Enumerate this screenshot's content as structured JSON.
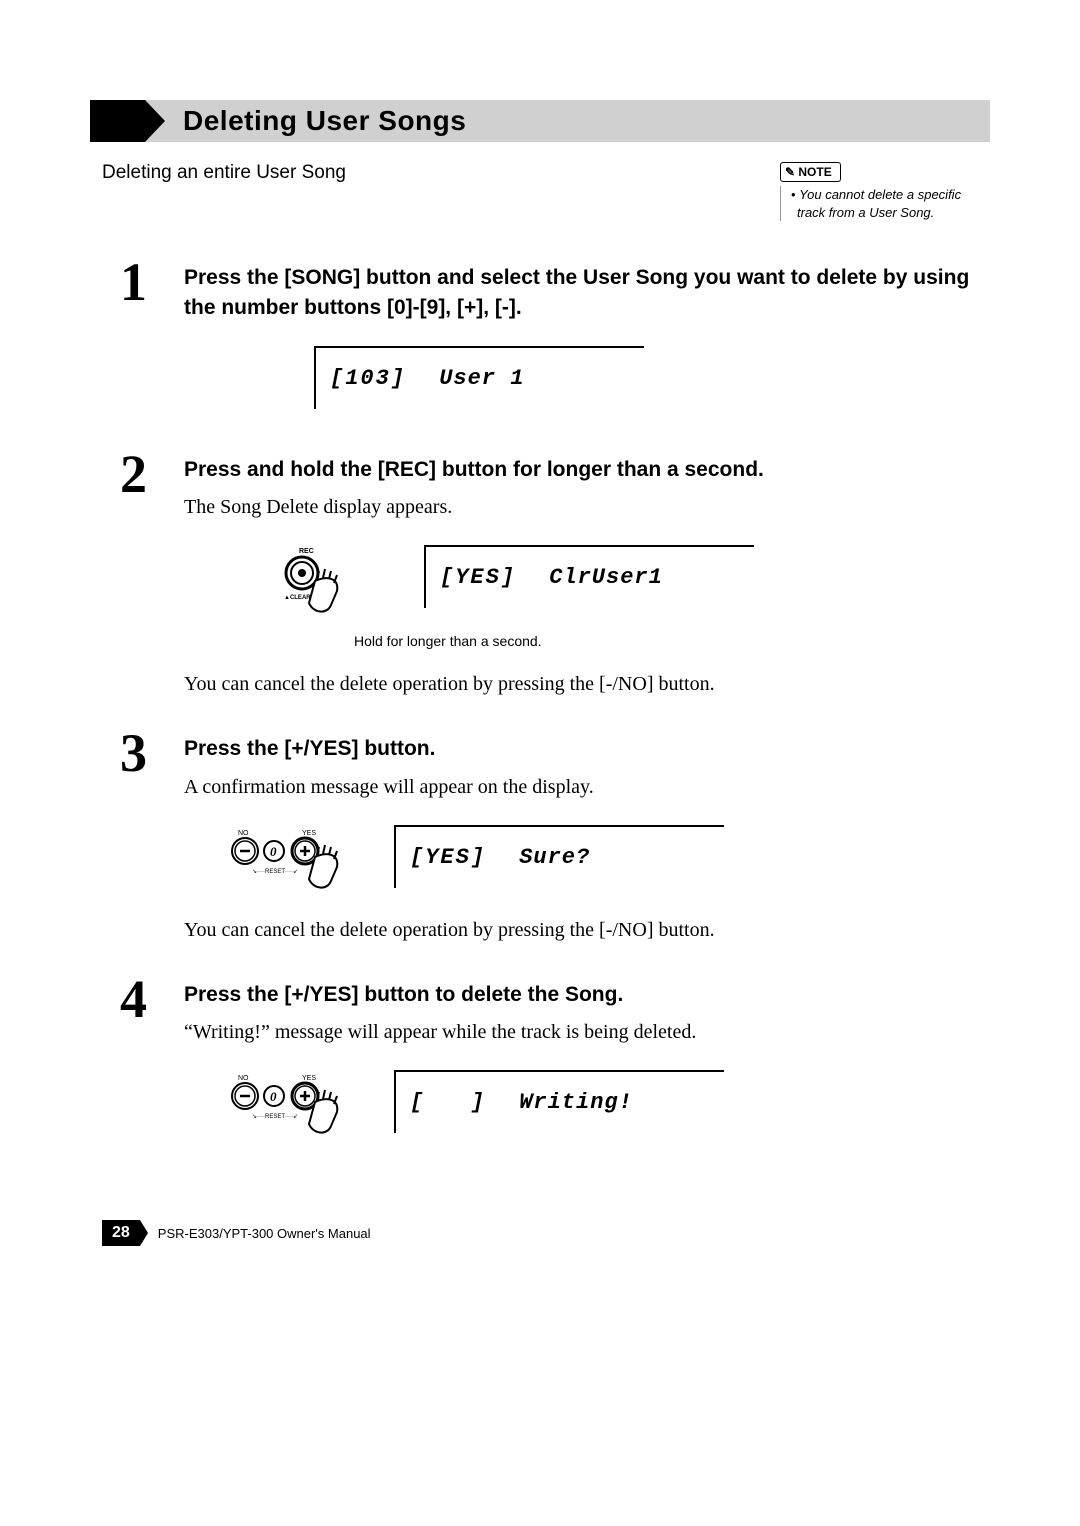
{
  "header": {
    "title": "Deleting User Songs"
  },
  "intro": "Deleting an entire User Song",
  "note": {
    "label": "NOTE",
    "items": [
      "You cannot delete a specific track from a User Song."
    ]
  },
  "steps": [
    {
      "num": "1",
      "title": "Press the [SONG] button and select the User Song you want to delete by using the number buttons [0]-[9], [+], [-].",
      "lcd_label": "103",
      "lcd_text": "User 1"
    },
    {
      "num": "2",
      "title": "Press and hold the [REC] button for longer than a second.",
      "desc1": "The Song Delete display appears.",
      "button_caption": "Hold for longer than a second.",
      "rec_label": "REC",
      "clear_label": "CLEAR",
      "lcd_label": "YES",
      "lcd_text": "ClrUser1",
      "desc2": "You can cancel the delete operation by pressing the [-/NO] button."
    },
    {
      "num": "3",
      "title": "Press the [+/YES] button.",
      "desc1": "A confirmation message will appear on the display.",
      "no_label": "NO",
      "yes_label": "YES",
      "reset_label": "RESET",
      "lcd_label": "YES",
      "lcd_text": "Sure?",
      "desc2": "You can cancel the delete operation by pressing the [-/NO] button."
    },
    {
      "num": "4",
      "title": "Press the [+/YES] button to delete the Song.",
      "desc1": "“Writing!” message will appear while the track is being deleted.",
      "no_label": "NO",
      "yes_label": "YES",
      "reset_label": "RESET",
      "lcd_label": "",
      "lcd_text": "Writing!"
    }
  ],
  "footer": {
    "page": "28",
    "manual": "PSR-E303/YPT-300  Owner's Manual"
  }
}
